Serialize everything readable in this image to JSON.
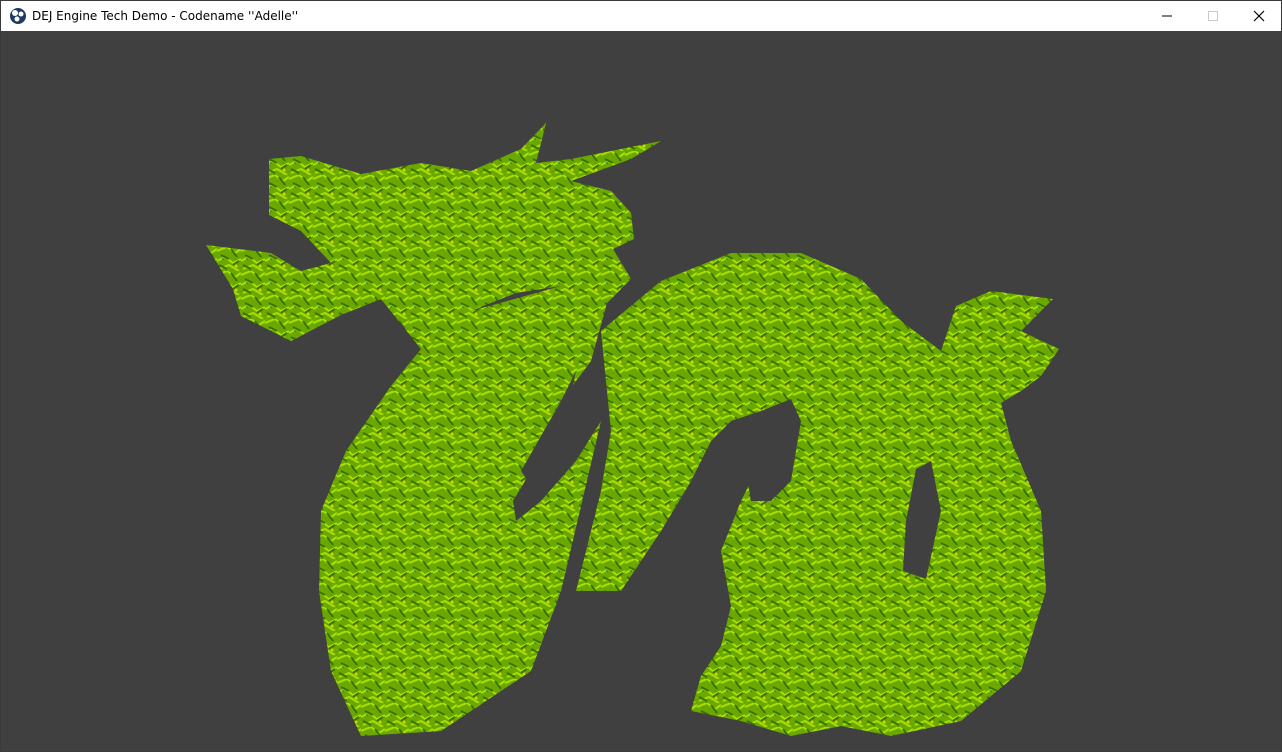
{
  "window": {
    "title": "DEJ Engine Tech Demo - Codename ''Adelle''",
    "icon": "app-logo-icon",
    "controls": [
      "minimize-icon",
      "maximize-icon",
      "close-icon"
    ]
  },
  "viewport": {
    "background_color": "#404040",
    "model_colors": [
      "#5a8a00",
      "#9ad800",
      "#6fc300",
      "#3b6f00",
      "#d7d400"
    ]
  }
}
